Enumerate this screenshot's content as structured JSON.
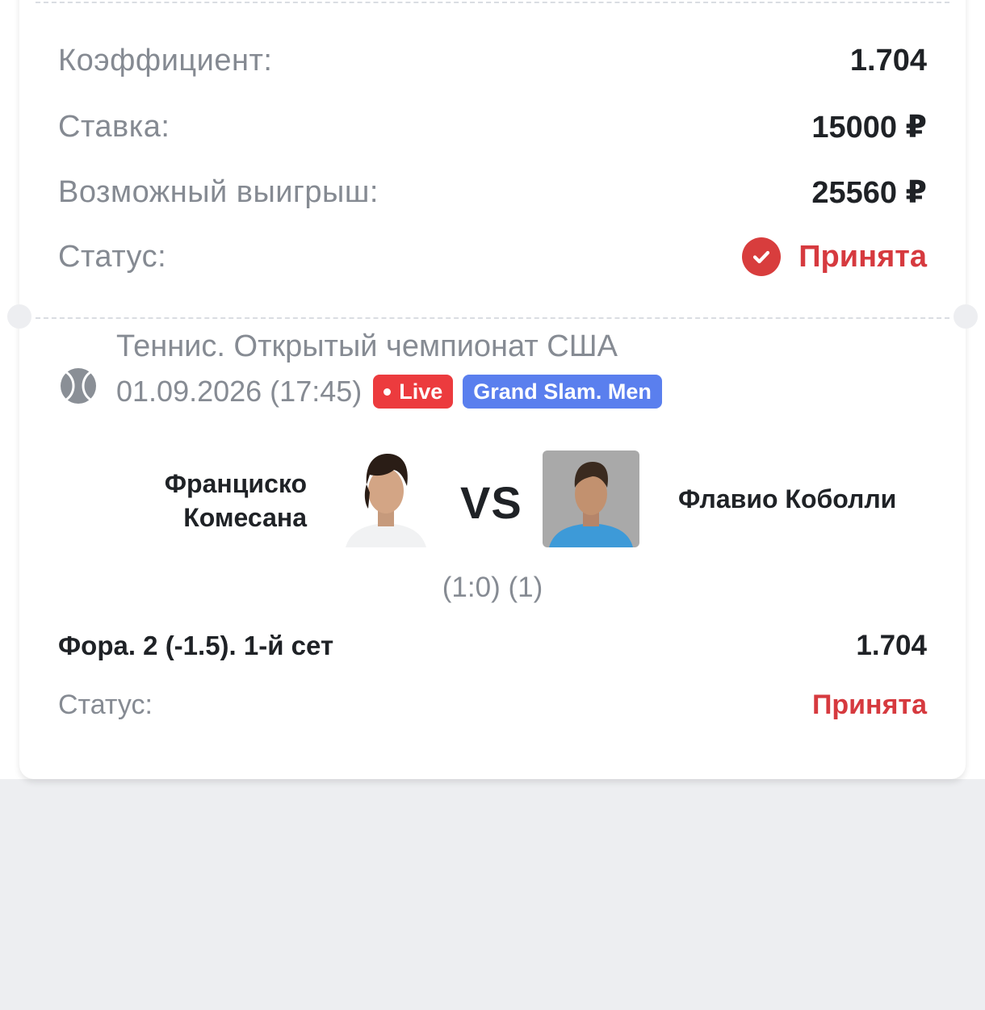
{
  "summary": {
    "odds_label": "Коэффициент:",
    "odds_value": "1.704",
    "stake_label": "Ставка:",
    "stake_value": "15000 ₽",
    "payout_label": "Возможный выигрыш:",
    "payout_value": "25560 ₽",
    "status_label": "Статус:",
    "status_value": "Принята"
  },
  "event": {
    "title": "Теннис. Открытый чемпионат США",
    "datetime": "01.09.2026 (17:45)",
    "live_badge": "Live",
    "league_badge": "Grand Slam. Men",
    "sport_icon": "tennis-ball-icon",
    "team1": "Франциско Комесана",
    "team2": "Флавио Коболли",
    "vs": "VS",
    "score": "(1:0) (1)"
  },
  "selection": {
    "market": "Фора. 2 (-1.5). 1-й сет",
    "odds": "1.704",
    "status_label": "Статус:",
    "status_value": "Принята"
  },
  "colors": {
    "accent_red": "#d63a3f",
    "live_badge": "#ec3b3e",
    "league_badge": "#5a7fee",
    "background": "#edeef1"
  }
}
